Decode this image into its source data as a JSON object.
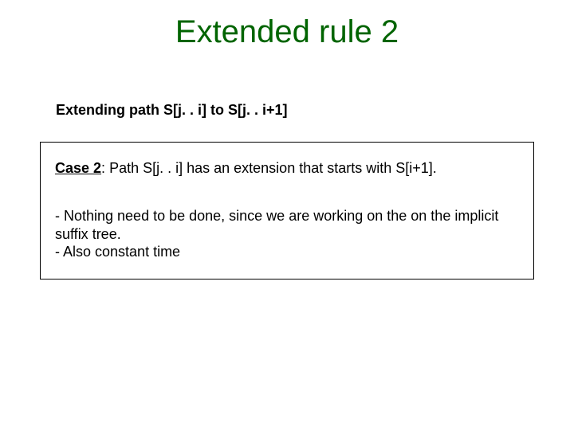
{
  "title": "Extended rule 2",
  "subtitle": "Extending path S[j. . i] to S[j. . i+1]",
  "case": {
    "label": "Case 2",
    "colon": ":",
    "rest": "  Path S[j. . i] has an extension that starts with S[i+1]."
  },
  "body": {
    "line1": " - Nothing need to be done, since we are working on the on the implicit suffix tree.",
    "line2": "- Also constant time"
  }
}
